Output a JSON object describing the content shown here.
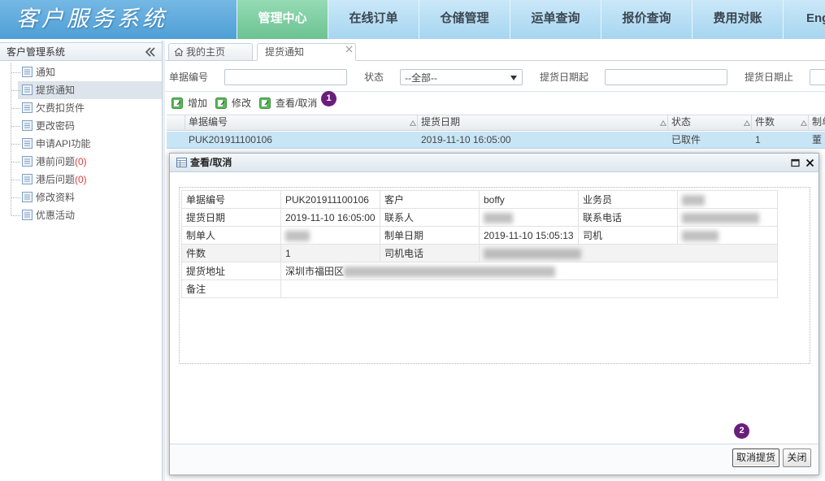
{
  "app": {
    "title": "客户服务系统"
  },
  "nav": {
    "items": [
      {
        "label": "管理中心",
        "active": true
      },
      {
        "label": "在线订单"
      },
      {
        "label": "仓储管理"
      },
      {
        "label": "运单查询"
      },
      {
        "label": "报价查询"
      },
      {
        "label": "费用对账"
      },
      {
        "label": "Eng"
      }
    ]
  },
  "sidebar": {
    "title": "客户管理系统",
    "collapse_icon": "double-chevron-left-icon",
    "items": [
      {
        "label": "通知",
        "icon": "document-list-icon"
      },
      {
        "label": "提货通知",
        "icon": "document-list-icon",
        "selected": true
      },
      {
        "label": "欠费扣货件",
        "icon": "document-list-icon"
      },
      {
        "label": "更改密码",
        "icon": "document-list-icon"
      },
      {
        "label": "申请API功能",
        "icon": "document-list-icon"
      },
      {
        "label": "港前问题",
        "count": "(0)",
        "icon": "document-list-icon"
      },
      {
        "label": "港后问题",
        "count": "(0)",
        "icon": "document-list-icon"
      },
      {
        "label": "修改资料",
        "icon": "document-list-icon"
      },
      {
        "label": "优惠活动",
        "icon": "document-list-icon"
      }
    ]
  },
  "tabs": [
    {
      "label": "我的主页",
      "icon": "home-icon"
    },
    {
      "label": "提货通知",
      "active": true,
      "close_icon": "close-icon"
    }
  ],
  "search": {
    "doc_no": {
      "label": "单据编号"
    },
    "status": {
      "label": "状态",
      "value": "--全部--"
    },
    "date_from": {
      "label": "提货日期起"
    },
    "date_to": {
      "label": "提货日期止"
    }
  },
  "toolbar": {
    "add": {
      "label": "增加",
      "icon": "add-icon"
    },
    "edit": {
      "label": "修改",
      "icon": "edit-icon"
    },
    "view_cancel": {
      "label": "查看/取消",
      "icon": "view-icon"
    }
  },
  "grid": {
    "columns": [
      "单据编号",
      "提货日期",
      "状态",
      "件数",
      "制单"
    ],
    "rows": [
      [
        "PUK201911100106",
        "2019-11-10 16:05:00",
        "已取件",
        "1",
        "董"
      ]
    ]
  },
  "dialog": {
    "title": "查看/取消",
    "title_icon": "table-icon",
    "form": {
      "doc_no": {
        "label": "单据编号",
        "value": "PUK201911100106"
      },
      "customer": {
        "label": "客户",
        "value": "boffy"
      },
      "salesman": {
        "label": "业务员"
      },
      "pickup_date": {
        "label": "提货日期",
        "value": "2019-11-10 16:05:00"
      },
      "contact": {
        "label": "联系人"
      },
      "contact_phone": {
        "label": "联系电话"
      },
      "creator": {
        "label": "制单人"
      },
      "create_date": {
        "label": "制单日期",
        "value": "2019-11-10 15:05:13"
      },
      "driver": {
        "label": "司机"
      },
      "quantity": {
        "label": "件数",
        "value": "1"
      },
      "driver_phone": {
        "label": "司机电话"
      },
      "address": {
        "label": "提货地址",
        "value": "深圳市福田区"
      },
      "remark": {
        "label": "备注"
      }
    },
    "buttons": {
      "cancel_pickup": "取消提货",
      "close": "关闭"
    }
  },
  "annotations": [
    "1",
    "2"
  ],
  "colors": {
    "header_blue": "#4f9fd5",
    "nav_bg": "#a6d5f0",
    "nav_active": "#6cc292",
    "selected_row": "#c8e5f6",
    "annotation": "#6a1e7b",
    "count_red": "#e03c3c"
  }
}
